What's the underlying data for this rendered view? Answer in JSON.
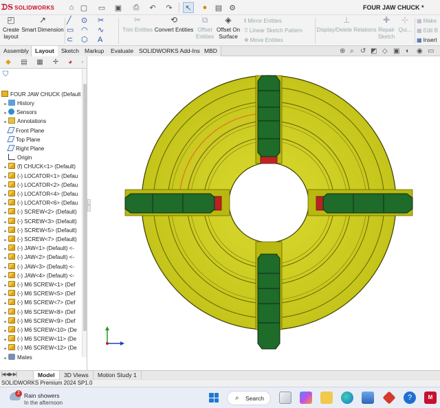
{
  "titlebar": {
    "logo": "SOLIDWORKS",
    "document_title": "FOUR JAW CHUCK *"
  },
  "command_manager": {
    "create_layout": "Create\nlayout",
    "smart_dimension": "Smart Dimension",
    "trim_entities": "Trim Entities",
    "convert_entities": "Convert Entities",
    "offset_entities": "Offset\nEntities",
    "offset_on_surface": "Offset On\nSurface",
    "mirror_entities": "Mirror Entities",
    "linear_sketch_pattern": "Linear Sketch Pattern",
    "move_entities": "Move Entities",
    "display_delete_relations": "Display/Delete Relations",
    "repair_sketch": "Repair\nSketch",
    "quick_snaps": "Qui...",
    "make_path": "Make",
    "edit_block": "Edit B",
    "insert_block": "Insert"
  },
  "tabs": [
    "Assembly",
    "Layout",
    "Sketch",
    "Markup",
    "Evaluate",
    "SOLIDWORKS Add-Ins",
    "MBD"
  ],
  "active_tab": "Layout",
  "feature_tree": {
    "root": "FOUR JAW CHUCK (Default",
    "items": [
      {
        "label": "History",
        "icon": "history-icon"
      },
      {
        "label": "Sensors",
        "icon": "sensor-icon"
      },
      {
        "label": "Annotations",
        "icon": "annotations-icon"
      },
      {
        "label": "Front Plane",
        "icon": "plane-icon"
      },
      {
        "label": "Top Plane",
        "icon": "plane-icon"
      },
      {
        "label": "Right Plane",
        "icon": "plane-icon"
      },
      {
        "label": "Origin",
        "icon": "origin-icon"
      },
      {
        "label": "(f) CHUCK<1> (Default)",
        "icon": "part-icon"
      },
      {
        "label": "(-) LOCATOR<1> (Defau",
        "icon": "part-icon"
      },
      {
        "label": "(-) LOCATOR<2> (Defau",
        "icon": "part-icon"
      },
      {
        "label": "(-) LOCATOR<4> (Defau",
        "icon": "part-icon"
      },
      {
        "label": "(-) LOCATOR<6> (Defau",
        "icon": "part-icon"
      },
      {
        "label": "(-) SCREW<2> (Default)",
        "icon": "part-icon"
      },
      {
        "label": "(-) SCREW<3> (Default)",
        "icon": "part-icon"
      },
      {
        "label": "(-) SCREW<5> (Default)",
        "icon": "part-icon"
      },
      {
        "label": "(-) SCREW<7> (Default)",
        "icon": "part-icon"
      },
      {
        "label": "(-) JAW<1> (Default) <-",
        "icon": "part-icon"
      },
      {
        "label": "(-) JAW<2> (Default) <-",
        "icon": "part-icon"
      },
      {
        "label": "(-) JAW<3> (Default) <-",
        "icon": "part-icon"
      },
      {
        "label": "(-) JAW<4> (Default) <-",
        "icon": "part-icon"
      },
      {
        "label": "(-) M6 SCREW<1> (Def",
        "icon": "part-icon"
      },
      {
        "label": "(-) M6 SCREW<5> (Def",
        "icon": "part-icon"
      },
      {
        "label": "(-) M6 SCREW<7> (Def",
        "icon": "part-icon"
      },
      {
        "label": "(-) M6 SCREW<8> (Def",
        "icon": "part-icon"
      },
      {
        "label": "(-) M6 SCREW<9> (Def",
        "icon": "part-icon"
      },
      {
        "label": "(-) M6 SCREW<10> (De",
        "icon": "part-icon"
      },
      {
        "label": "(-) M6 SCREW<11> (De",
        "icon": "part-icon"
      },
      {
        "label": "(-) M6 SCREW<12> (De",
        "icon": "part-icon"
      },
      {
        "label": "Mates",
        "icon": "mates-icon"
      }
    ]
  },
  "model": {
    "body_color": "#c8c81e",
    "jaw_color": "#1f6b2a",
    "screw_color": "#d42a2a"
  },
  "bottom_tabs": [
    "Model",
    "3D Views",
    "Motion Study 1"
  ],
  "active_bottom_tab": "Model",
  "status_bar": "SOLIDWORKS Premium 2024 SP1.0",
  "taskbar": {
    "weather_badge": "2",
    "weather_title": "Rain showers",
    "weather_sub": "In the afternoon",
    "search_label": "Search"
  }
}
